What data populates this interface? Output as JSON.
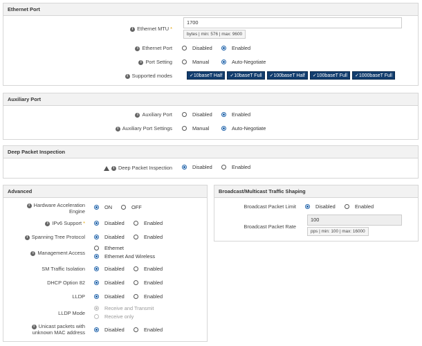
{
  "ethernet": {
    "title": "Ethernet Port",
    "mtu_label": "Ethernet MTU",
    "mtu_required": "*",
    "mtu_value": "1700",
    "mtu_hint": "bytes | min: 576 | max: 9600",
    "port_label": "Ethernet Port",
    "port_opt1": "Disabled",
    "port_opt2": "Enabled",
    "setting_label": "Port Setting",
    "setting_opt1": "Manual",
    "setting_opt2": "Auto-Negotiate",
    "modes_label": "Supported modes",
    "modes": [
      "✓10baseT Half",
      "✓10baseT Full",
      "✓100baseT Half",
      "✓100baseT Full",
      "✓1000baseT Full"
    ]
  },
  "aux": {
    "title": "Auxiliary Port",
    "port_label": "Auxiliary Port",
    "port_opt1": "Disabled",
    "port_opt2": "Enabled",
    "settings_label": "Auxiliary Port Settings",
    "settings_opt1": "Manual",
    "settings_opt2": "Auto-Negotiate"
  },
  "dpi": {
    "title": "Deep Packet Inspection",
    "label": "Deep Packet Inspection",
    "opt1": "Disabled",
    "opt2": "Enabled"
  },
  "advanced": {
    "title": "Advanced",
    "hw_label_1": "Hardware Acceleration",
    "hw_label_2": "Engine",
    "hw_opt1": "ON",
    "hw_opt2": "OFF",
    "ipv6_label": "IPv6 Support",
    "ipv6_required": "*",
    "stp_label": "Spanning Tree Protocol",
    "mgmt_label": "Management Access",
    "mgmt_opt1": "Ethernet",
    "mgmt_opt2": "Ethernet And Wireless",
    "sm_label": "SM Traffic Isolation",
    "dhcp_label": "DHCP Option 82",
    "lldp_label": "LLDP",
    "lldpmode_label": "LLDP Mode",
    "lldpmode_opt1": "Receive and Transmit",
    "lldpmode_opt2": "Receive only",
    "unicast_label_1": "Unicast packets with",
    "unicast_label_2": "unknown MAC address",
    "disabled": "Disabled",
    "enabled": "Enabled"
  },
  "broadcast": {
    "title": "Broadcast/Multicast Traffic Shaping",
    "limit_label": "Broadcast Packet Limit",
    "limit_opt1": "Disabled",
    "limit_opt2": "Enabled",
    "rate_label": "Broadcast Packet Rate",
    "rate_value": "100",
    "rate_hint": "pps | min: 100 | max: 16000"
  },
  "colors": {
    "accent": "#1a5fa8",
    "chip_bg": "#123d6e",
    "required": "#e0a000"
  }
}
